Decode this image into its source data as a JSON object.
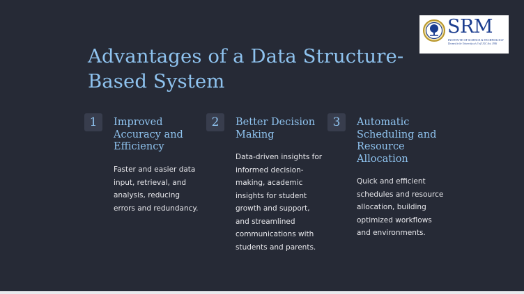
{
  "slide": {
    "title": "Advantages of a Data Structure-Based System"
  },
  "logo": {
    "name": "SRM",
    "subtitle": "INSTITUTE OF SCIENCE & TECHNOLOGY",
    "tagline": "Deemed to be University u/s 3 of UGC Act, 1956"
  },
  "cards": [
    {
      "number": "1",
      "heading": "Improved Accuracy and Efficiency",
      "body": "Faster and easier data input, retrieval, and analysis, reducing errors and redundancy."
    },
    {
      "number": "2",
      "heading": "Better Decision Making",
      "body": "Data-driven insights for informed decision-making, academic insights for student growth and support, and streamlined communications with students and parents."
    },
    {
      "number": "3",
      "heading": "Automatic Scheduling and Resource Allocation",
      "body": "Quick and efficient schedules and resource allocation, building optimized workflows and environments."
    }
  ],
  "colors": {
    "background": "#262a36",
    "accent": "#8fc3ef",
    "body_text": "#e8e8ec",
    "badge": "#383d4d",
    "logo_blue": "#1b3d8f"
  }
}
